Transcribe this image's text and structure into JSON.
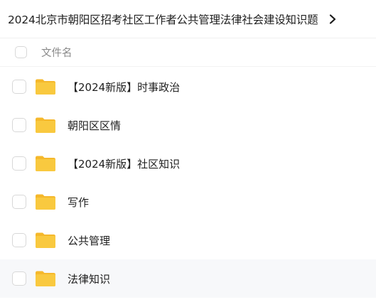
{
  "breadcrumb": {
    "title": "2024北京市朝阳区招考社区工作者公共管理法律社会建设知识题",
    "chevron_icon": "chevron-right-icon"
  },
  "list_header": {
    "column_label": "文件名"
  },
  "colors": {
    "folder": "#f8c53a",
    "folder_back": "#f5b82b",
    "row_hover": "#f7f8fa",
    "checkbox_border": "#d8d8d8"
  },
  "files": [
    {
      "name": "【2024新版】时事政治",
      "icon": "folder-icon"
    },
    {
      "name": "朝阳区区情",
      "icon": "folder-icon"
    },
    {
      "name": "【2024新版】社区知识",
      "icon": "folder-icon"
    },
    {
      "name": "写作",
      "icon": "folder-icon"
    },
    {
      "name": "公共管理",
      "icon": "folder-icon"
    },
    {
      "name": "法律知识",
      "icon": "folder-icon"
    }
  ]
}
